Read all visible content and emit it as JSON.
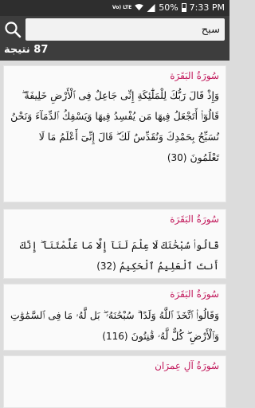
{
  "status_bar": {
    "volte": "Vo) LTE",
    "battery": "50%",
    "time": "7:33 PM"
  },
  "search": {
    "query": "سبح",
    "icon": "search-icon"
  },
  "results": {
    "count": "87 نتيجة"
  },
  "cards": [
    {
      "sura": "سُورَةُ البَقَرَة",
      "text": "وَإِذْ قَالَ رَبُّكَ لِلْمَلَٰٓئِكَةِ إِنِّى جَاعِلٌ فِى ٱلْأَرْضِ خَلِيفَةً ۖ قَالُوٓا۟ أَتَجْعَلُ فِيهَا مَن يُفْسِدُ فِيهَا وَيَسْفِكُ ٱلدِّمَآءَ وَنَحْنُ نُسَبِّحُ بِحَمْدِكَ وَنُقَدِّسُ لَكَ ۖ قَالَ إِنِّىٓ أَعْلَمُ مَا لَا تَعْلَمُونَ",
      "number": "(30)"
    },
    {
      "sura": "سُورَةُ البَقَرَة",
      "text": "قَالُوا۟ سُبْحَٰنَكَ لَا عِلْمَ لَنَآ إِلَّا مَا عَلَّمْتَنَآ ۖ إِنَّكَ أَنتَ ٱلْعَلِيمُ ٱلْحَكِيمُ",
      "number": "(32)"
    },
    {
      "sura": "سُورَةُ البَقَرَة",
      "text": "وَقَالُوا۟ ٱتَّخَذَ ٱللَّهُ وَلَدًا ۗ سُبْحَٰنَهُۥ ۖ بَل لَّهُۥ مَا فِى ٱلسَّمَٰوَٰتِ وَٱلْأَرْضِ ۖ كُلٌّ لَّهُۥ قَٰنِتُونَ",
      "number": "(116)"
    },
    {
      "sura": "سُورَةُ آلِ عِمرَان",
      "text": "",
      "number": ""
    }
  ]
}
